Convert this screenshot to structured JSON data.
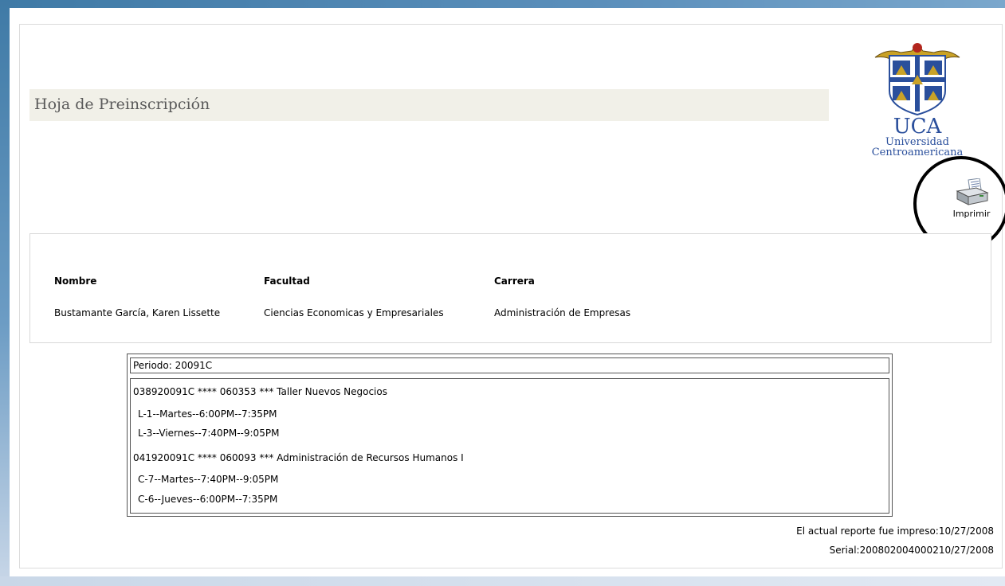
{
  "page": {
    "title": "Hoja de Preinscripción"
  },
  "logo": {
    "uca": "UCA",
    "line1": "Universidad",
    "line2": "Centroamericana"
  },
  "print": {
    "label": "Imprimir"
  },
  "student": {
    "headers": {
      "name": "Nombre",
      "faculty": "Facultad",
      "career": "Carrera"
    },
    "values": {
      "name": "Bustamante García, Karen Lissette",
      "faculty": "Ciencias Economicas y Empresariales",
      "career": "Administración de Empresas"
    }
  },
  "schedule": {
    "period": "Periodo: 20091C",
    "courses": [
      {
        "header": "038920091C **** 060353 *** Taller Nuevos Negocios",
        "sessions": [
          "L-1--Martes--6:00PM--7:35PM",
          "L-3--Viernes--7:40PM--9:05PM"
        ]
      },
      {
        "header": "041920091C **** 060093 *** Administración de Recursos Humanos I",
        "sessions": [
          "C-7--Martes--7:40PM--9:05PM",
          "C-6--Jueves--6:00PM--7:35PM"
        ]
      }
    ]
  },
  "footer": {
    "printed": "El actual reporte fue impreso:10/27/2008",
    "serial": "Serial:200802004000210/27/2008"
  },
  "colors": {
    "frame": "#3f7aa6",
    "title_bar": "#f1f0e8",
    "logo_blue": "#2a4f9c"
  }
}
